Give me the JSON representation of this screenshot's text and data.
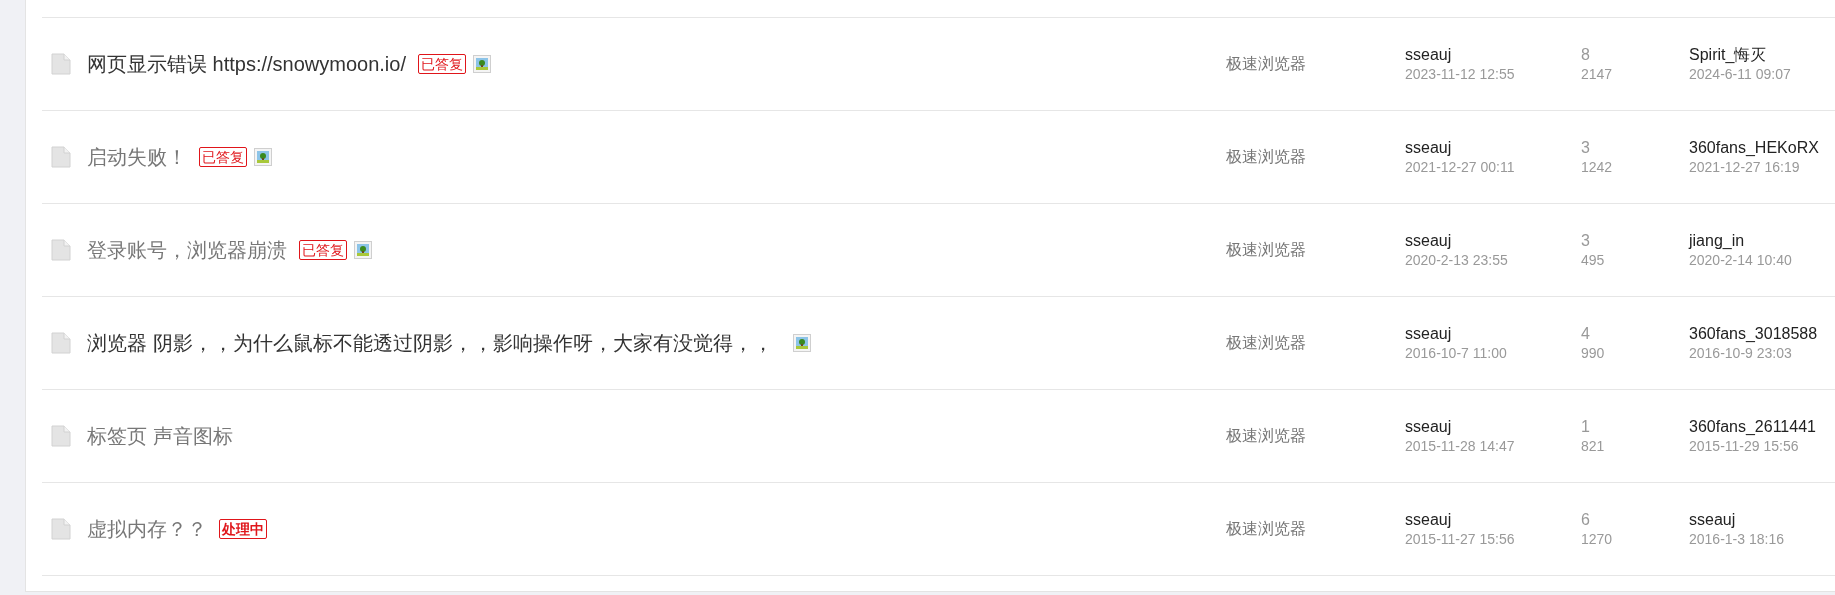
{
  "threads": [
    {
      "title": "网页显示错误 https://snowymoon.io/",
      "visited": false,
      "badge": {
        "text": "已答复",
        "kind": "answered"
      },
      "has_image": true,
      "category": "极速浏览器",
      "author": "sseauj",
      "posted": "2023-11-12 12:55",
      "replies": "8",
      "views": "2147",
      "last_user": "Spirit_悔灭",
      "last_time": "2024-6-11 09:07"
    },
    {
      "title": "启动失败！",
      "visited": true,
      "badge": {
        "text": "已答复",
        "kind": "answered"
      },
      "has_image": true,
      "category": "极速浏览器",
      "author": "sseauj",
      "posted": "2021-12-27 00:11",
      "replies": "3",
      "views": "1242",
      "last_user": "360fans_HEKoRX",
      "last_time": "2021-12-27 16:19"
    },
    {
      "title": "登录账号，浏览器崩溃",
      "visited": true,
      "badge": {
        "text": "已答复",
        "kind": "answered"
      },
      "has_image": true,
      "category": "极速浏览器",
      "author": "sseauj",
      "posted": "2020-2-13 23:55",
      "replies": "3",
      "views": "495",
      "last_user": "jiang_in",
      "last_time": "2020-2-14 10:40"
    },
    {
      "title": "浏览器 阴影，，为什么鼠标不能透过阴影，，影响操作呀，大家有没觉得，，",
      "visited": false,
      "has_image": true,
      "category": "极速浏览器",
      "author": "sseauj",
      "posted": "2016-10-7 11:00",
      "replies": "4",
      "views": "990",
      "last_user": "360fans_3018588",
      "last_time": "2016-10-9 23:03"
    },
    {
      "title": "标签页 声音图标",
      "visited": true,
      "has_image": false,
      "category": "极速浏览器",
      "author": "sseauj",
      "posted": "2015-11-28 14:47",
      "replies": "1",
      "views": "821",
      "last_user": "360fans_2611441",
      "last_time": "2015-11-29 15:56"
    },
    {
      "title": "虚拟内存？？",
      "visited": true,
      "badge": {
        "text": "处理中",
        "kind": "processing"
      },
      "has_image": false,
      "category": "极速浏览器",
      "author": "sseauj",
      "posted": "2015-11-27 15:56",
      "replies": "6",
      "views": "1270",
      "last_user": "sseauj",
      "last_time": "2016-1-3 18:16"
    }
  ]
}
